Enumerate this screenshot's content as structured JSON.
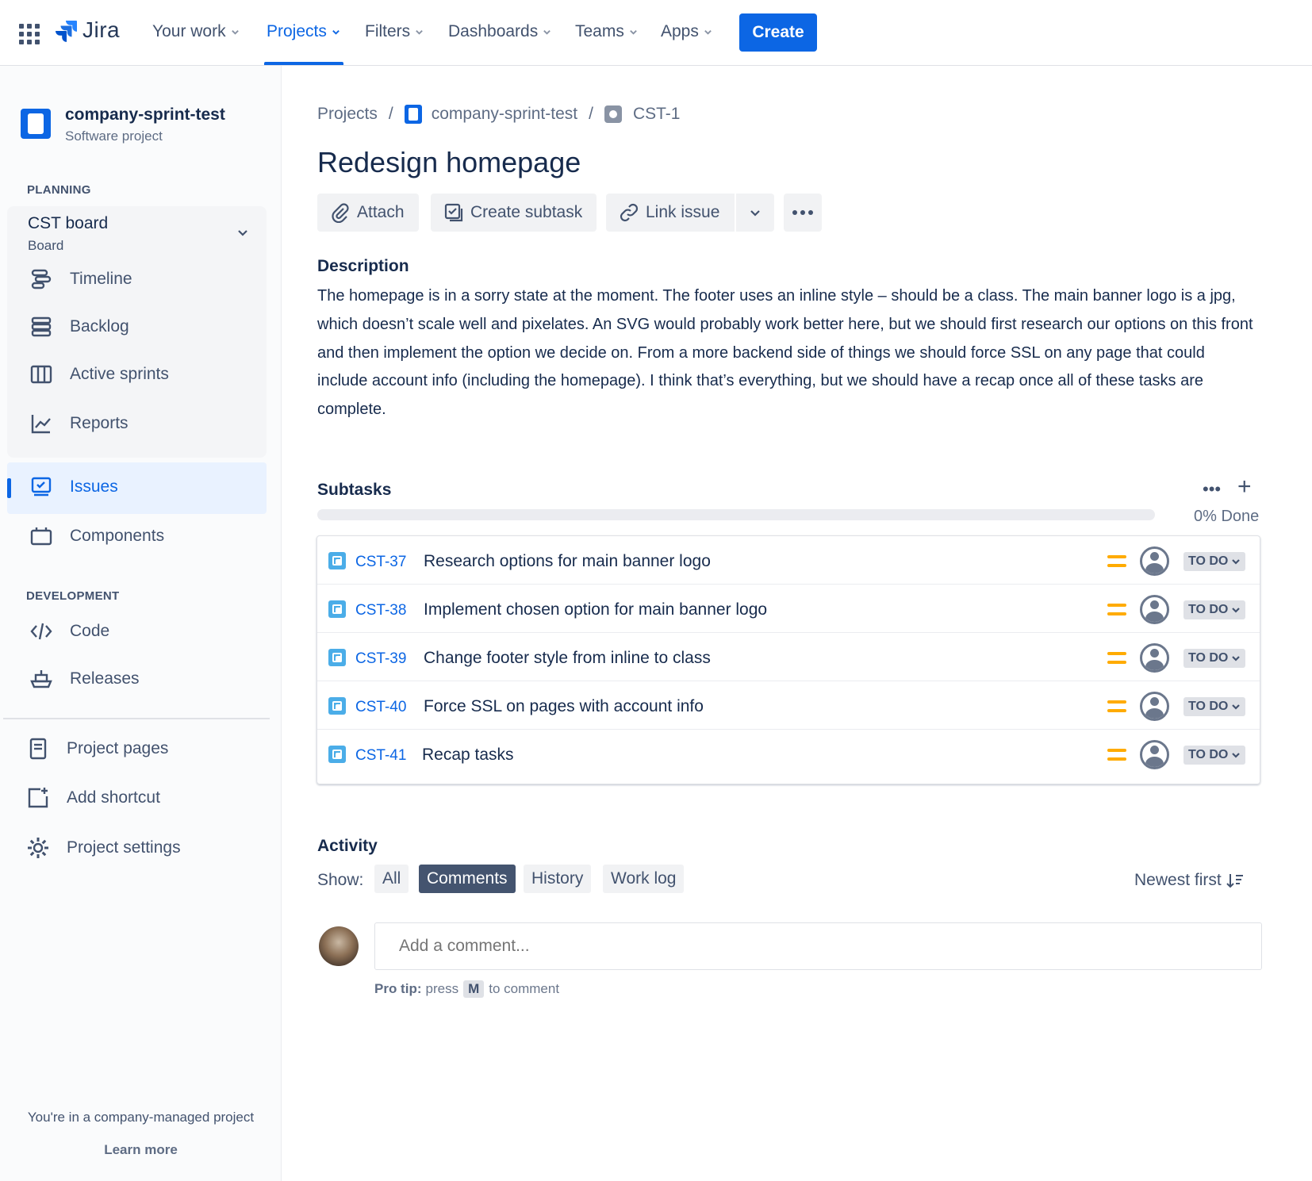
{
  "topnav": {
    "app_name": "Jira",
    "items": [
      {
        "label": "Your work"
      },
      {
        "label": "Projects"
      },
      {
        "label": "Filters"
      },
      {
        "label": "Dashboards"
      },
      {
        "label": "Teams"
      },
      {
        "label": "Apps"
      }
    ],
    "active_item": "Projects",
    "create_label": "Create",
    "accent_color": "#0C66E4"
  },
  "sidebar": {
    "project_name": "company-sprint-test",
    "project_type": "Software project",
    "planning_heading": "PLANNING",
    "board": {
      "title": "CST board",
      "subtitle": "Board"
    },
    "planning_items": [
      {
        "label": "Timeline",
        "icon": "timeline-icon"
      },
      {
        "label": "Backlog",
        "icon": "backlog-icon"
      },
      {
        "label": "Active sprints",
        "icon": "board-icon"
      },
      {
        "label": "Reports",
        "icon": "chart-icon"
      }
    ],
    "issues_label": "Issues",
    "components_label": "Components",
    "development_heading": "DEVELOPMENT",
    "development_items": [
      {
        "label": "Code",
        "icon": "code-icon"
      },
      {
        "label": "Releases",
        "icon": "ship-icon"
      }
    ],
    "bottom_items": [
      {
        "label": "Project pages",
        "icon": "page-icon"
      },
      {
        "label": "Add shortcut",
        "icon": "add-shortcut-icon"
      },
      {
        "label": "Project settings",
        "icon": "gear-icon"
      }
    ],
    "footer_text": "You're in a company-managed project",
    "learn_more": "Learn more"
  },
  "breadcrumb": {
    "root": "Projects",
    "project": "company-sprint-test",
    "issue_key": "CST-1"
  },
  "issue": {
    "title": "Redesign homepage",
    "actions": {
      "attach": "Attach",
      "create_subtask": "Create subtask",
      "link_issue": "Link issue"
    },
    "description_label": "Description",
    "description": "The homepage is in a sorry state at the moment. The footer uses an inline style – should be a class. The main banner logo is a jpg, which doesn’t scale well and pixelates. An SVG would probably work better here, but we should first research our options on this front and then implement the option we decide on. From a more backend side of things we should force SSL on any page that could include account info (including the homepage). I think that’s everything, but we should have a recap once all of these tasks are complete."
  },
  "subtasks": {
    "label": "Subtasks",
    "progress_percent": 0,
    "progress_text": "0% Done",
    "items": [
      {
        "key": "CST-37",
        "summary": "Research options for main banner logo",
        "priority": "medium",
        "status": "TO DO"
      },
      {
        "key": "CST-38",
        "summary": "Implement chosen option for main banner logo",
        "priority": "medium",
        "status": "TO DO"
      },
      {
        "key": "CST-39",
        "summary": "Change footer style from inline to class",
        "priority": "medium",
        "status": "TO DO"
      },
      {
        "key": "CST-40",
        "summary": "Force SSL on pages with account info",
        "priority": "medium",
        "status": "TO DO"
      },
      {
        "key": "CST-41",
        "summary": "Recap tasks",
        "priority": "medium",
        "status": "TO DO"
      }
    ]
  },
  "activity": {
    "label": "Activity",
    "show_label": "Show:",
    "filters": [
      {
        "label": "All"
      },
      {
        "label": "Comments"
      },
      {
        "label": "History"
      },
      {
        "label": "Work log"
      }
    ],
    "selected_filter": "Comments",
    "sort_label": "Newest first",
    "comment_placeholder": "Add a comment...",
    "protip_bold": "Pro tip:",
    "protip_pre": "press",
    "protip_key": "M",
    "protip_post": "to comment"
  }
}
